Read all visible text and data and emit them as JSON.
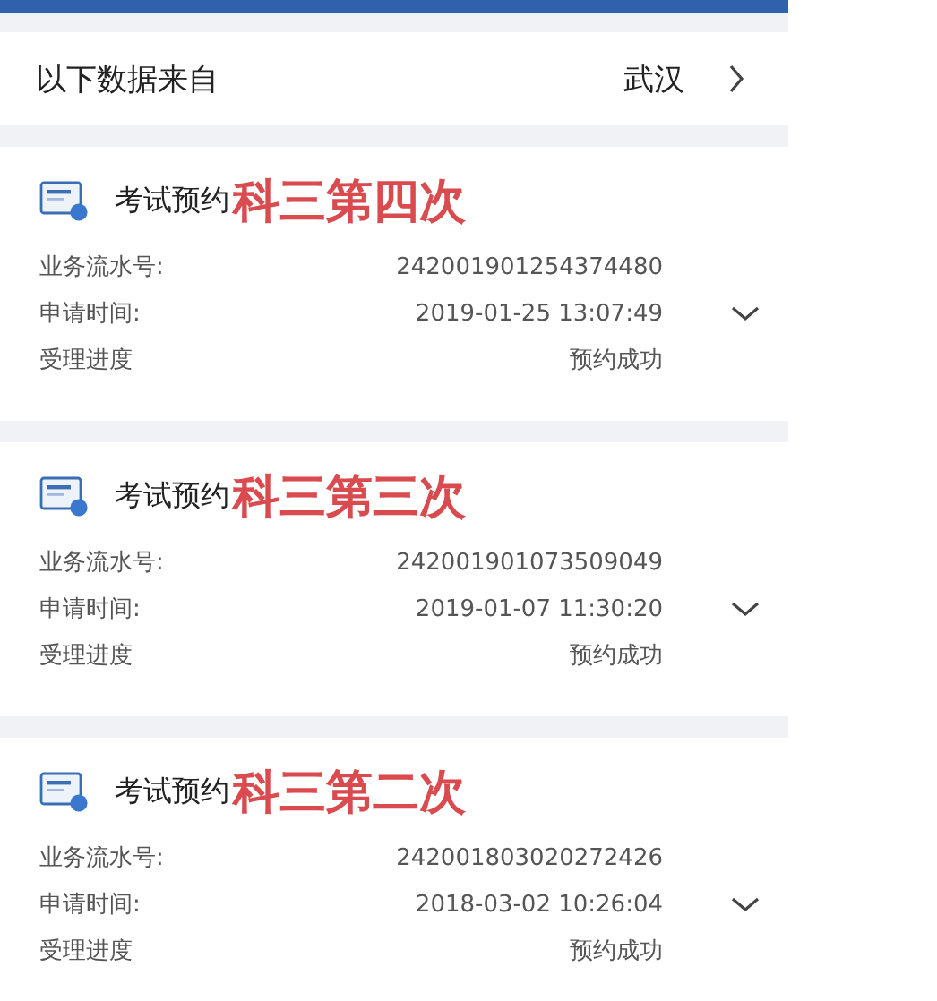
{
  "source_row": {
    "label": "以下数据来自",
    "city": "武汉"
  },
  "records": [
    {
      "title": "考试预约",
      "annotation": "科三第四次",
      "fields": [
        {
          "label": "业务流水号:",
          "value": "242001901254374480"
        },
        {
          "label": "申请时间:",
          "value": "2019-01-25 13:07:49"
        },
        {
          "label": "受理进度",
          "value": "预约成功"
        }
      ]
    },
    {
      "title": "考试预约",
      "annotation": "科三第三次",
      "fields": [
        {
          "label": "业务流水号:",
          "value": "242001901073509049"
        },
        {
          "label": "申请时间:",
          "value": "2019-01-07 11:30:20"
        },
        {
          "label": "受理进度",
          "value": "预约成功"
        }
      ]
    },
    {
      "title": "考试预约",
      "annotation": "科三第二次",
      "fields": [
        {
          "label": "业务流水号:",
          "value": "242001803020272426"
        },
        {
          "label": "申请时间:",
          "value": "2018-03-02 10:26:04"
        },
        {
          "label": "受理进度",
          "value": "预约成功"
        }
      ]
    }
  ]
}
